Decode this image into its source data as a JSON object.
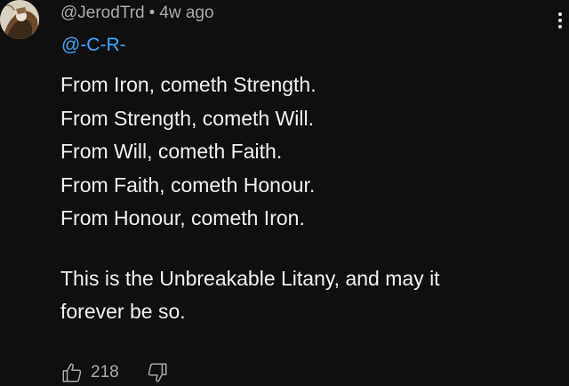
{
  "comment": {
    "author": "@JerodTrd",
    "separator": "•",
    "time_ago": "4w ago",
    "mention": "@-C-R-",
    "lines": [
      "From Iron, cometh Strength.",
      "From Strength, cometh Will.",
      "From Will, cometh Faith.",
      "From Faith, cometh Honour.",
      "From Honour, cometh Iron."
    ],
    "closing": "This is the Unbreakable Litany, and may it forever be so.",
    "like_count": "218",
    "icons": {
      "like": "thumbs-up-icon",
      "dislike": "thumbs-down-icon",
      "menu": "kebab-menu-icon"
    }
  },
  "colors": {
    "background": "#0f0f0f",
    "text": "#f1f1f1",
    "muted": "#aaaaaa",
    "link": "#3ea6ff"
  }
}
